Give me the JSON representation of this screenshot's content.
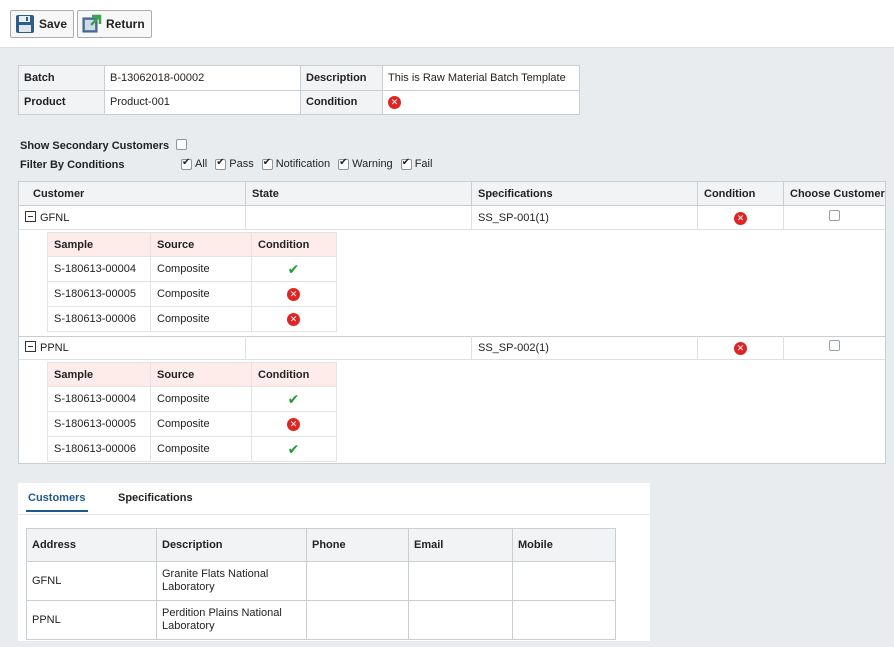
{
  "toolbar": {
    "save_label": "Save",
    "return_label": "Return"
  },
  "info": {
    "batch_label": "Batch",
    "batch_value": "B-13062018-00002",
    "description_label": "Description",
    "description_value": "This is Raw Material Batch Template",
    "product_label": "Product",
    "product_value": "Product-001",
    "condition_label": "Condition",
    "condition_state": "fail"
  },
  "options": {
    "show_secondary_label": "Show Secondary Customers",
    "show_secondary_checked": false,
    "filter_label": "Filter By Conditions",
    "filters": [
      {
        "label": "All",
        "checked": true
      },
      {
        "label": "Pass",
        "checked": true
      },
      {
        "label": "Notification",
        "checked": true
      },
      {
        "label": "Warning",
        "checked": true
      },
      {
        "label": "Fail",
        "checked": true
      }
    ]
  },
  "grid": {
    "headers": {
      "customer": "Customer",
      "state": "State",
      "specifications": "Specifications",
      "condition": "Condition",
      "choose": "Choose Customer"
    },
    "sub_headers": {
      "sample": "Sample",
      "source": "Source",
      "condition": "Condition"
    },
    "groups": [
      {
        "customer": "GFNL",
        "state": "",
        "specifications": "SS_SP-001(1)",
        "condition": "fail",
        "samples": [
          {
            "sample": "S-180613-00004",
            "source": "Composite",
            "condition": "pass"
          },
          {
            "sample": "S-180613-00005",
            "source": "Composite",
            "condition": "fail"
          },
          {
            "sample": "S-180613-00006",
            "source": "Composite",
            "condition": "fail"
          }
        ]
      },
      {
        "customer": "PPNL",
        "state": "",
        "specifications": "SS_SP-002(1)",
        "condition": "fail",
        "samples": [
          {
            "sample": "S-180613-00004",
            "source": "Composite",
            "condition": "pass"
          },
          {
            "sample": "S-180613-00005",
            "source": "Composite",
            "condition": "fail"
          },
          {
            "sample": "S-180613-00006",
            "source": "Composite",
            "condition": "pass"
          }
        ]
      }
    ]
  },
  "tabs": {
    "customers": "Customers",
    "specifications": "Specifications"
  },
  "customers_table": {
    "headers": {
      "address": "Address",
      "description": "Description",
      "phone": "Phone",
      "email": "Email",
      "mobile": "Mobile"
    },
    "rows": [
      {
        "address": "GFNL",
        "description": "Granite Flats National Laboratory",
        "phone": "",
        "email": "",
        "mobile": ""
      },
      {
        "address": "PPNL",
        "description": "Perdition Plains National Laboratory",
        "phone": "",
        "email": "",
        "mobile": ""
      }
    ]
  }
}
